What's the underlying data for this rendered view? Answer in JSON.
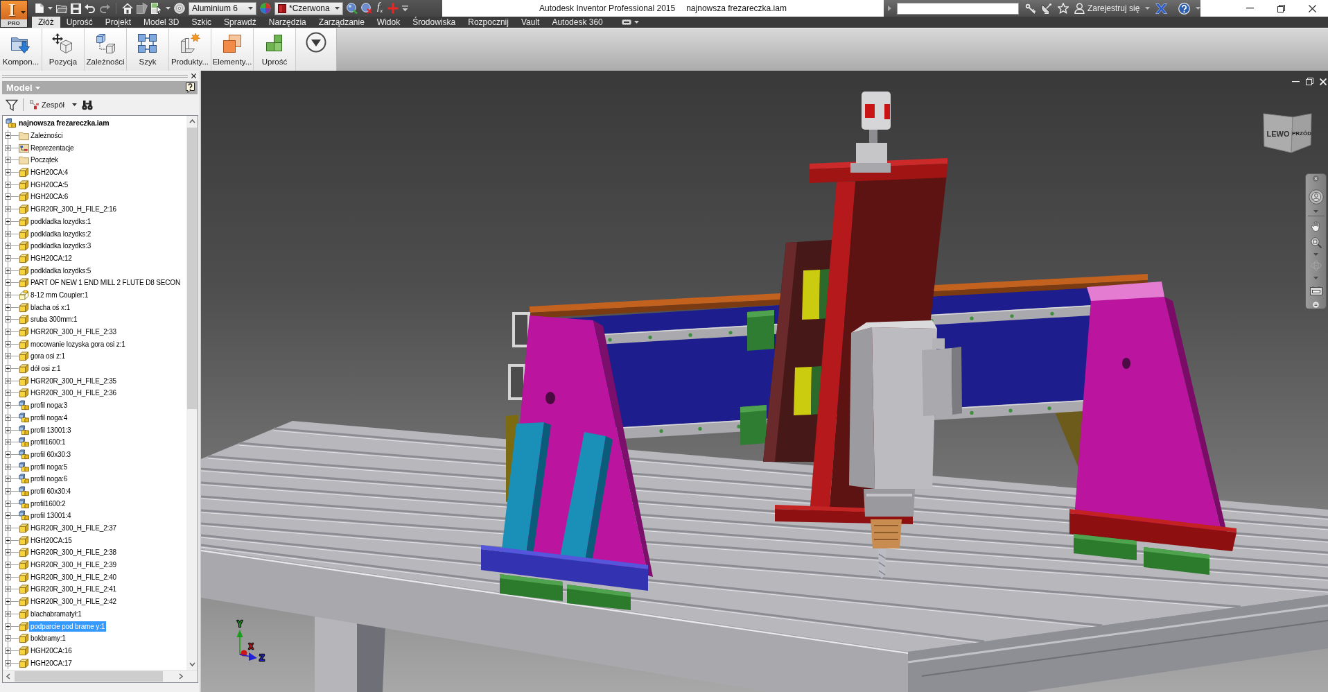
{
  "app_button": {
    "logo": "I",
    "edition": "PRO"
  },
  "quick_access": {
    "material": "Aluminium 6",
    "appearance": "*Czerwona",
    "parameters": "f$_{x}$"
  },
  "window": {
    "title": "Autodesk Inventor Professional 2015",
    "document": "najnowsza frezareczka.iam"
  },
  "info_center": {
    "sign_in": "Zarejestruj się"
  },
  "ribbon": {
    "tabs": [
      {
        "label": "Złóż",
        "selected": true
      },
      {
        "label": "Uprość",
        "selected": false
      },
      {
        "label": "Projekt",
        "selected": false
      },
      {
        "label": "Model 3D",
        "selected": false
      },
      {
        "label": "Szkic",
        "selected": false
      },
      {
        "label": "Sprawdź",
        "selected": false
      },
      {
        "label": "Narzędzia",
        "selected": false
      },
      {
        "label": "Zarządzanie",
        "selected": false
      },
      {
        "label": "Widok",
        "selected": false
      },
      {
        "label": "Środowiska",
        "selected": false
      },
      {
        "label": "Rozpocznij",
        "selected": false
      },
      {
        "label": "Vault",
        "selected": false
      },
      {
        "label": "Autodesk 360",
        "selected": false
      }
    ],
    "tools": [
      {
        "label": "Kompon...",
        "kind": "place"
      },
      {
        "label": "Pozycja",
        "kind": "move"
      },
      {
        "label": "Zależności",
        "kind": "constrain"
      },
      {
        "label": "Szyk",
        "kind": "pattern"
      },
      {
        "label": "Produkty...",
        "kind": "productivity"
      },
      {
        "label": "Elementy...",
        "kind": "components"
      },
      {
        "label": "Uprość",
        "kind": "simplify"
      }
    ]
  },
  "browser": {
    "title": "Model",
    "view": "Zespół",
    "tree": {
      "label": "najnowsza frezareczka.iam",
      "kind": "assembly",
      "selected": false,
      "children": [
        {
          "label": "Zależności",
          "kind": "folder",
          "expanded": false,
          "selected": false
        },
        {
          "label": "Reprezentacje",
          "kind": "representations",
          "expanded": false,
          "selected": false
        },
        {
          "label": "Początek",
          "kind": "folder",
          "expanded": false,
          "selected": false
        },
        {
          "label": "HGH20CA:4",
          "kind": "part",
          "expanded": false,
          "selected": false
        },
        {
          "label": "HGH20CA:5",
          "kind": "part",
          "expanded": false,
          "selected": false
        },
        {
          "label": "HGH20CA:6",
          "kind": "part",
          "expanded": false,
          "selected": false
        },
        {
          "label": "HGR20R_300_H_FILE_2:16",
          "kind": "part",
          "expanded": false,
          "selected": false
        },
        {
          "label": "podkladka lozydks:1",
          "kind": "part",
          "expanded": false,
          "selected": false
        },
        {
          "label": "podkladka lozydks:2",
          "kind": "part",
          "expanded": false,
          "selected": false
        },
        {
          "label": "podkladka lozydks:3",
          "kind": "part",
          "expanded": false,
          "selected": false
        },
        {
          "label": "HGH20CA:12",
          "kind": "part",
          "expanded": false,
          "selected": false
        },
        {
          "label": "podkladka lozydks:5",
          "kind": "part",
          "expanded": false,
          "selected": false
        },
        {
          "label": "PART OF NEW 1 END MILL 2 FLUTE D8 SECON",
          "kind": "part",
          "expanded": false,
          "selected": false
        },
        {
          "label": "8-12 mm Coupler:1",
          "kind": "part_outline",
          "expanded": false,
          "selected": false
        },
        {
          "label": "blacha oś x:1",
          "kind": "part",
          "expanded": false,
          "selected": false
        },
        {
          "label": "sruba 300mm:1",
          "kind": "part",
          "expanded": false,
          "selected": false
        },
        {
          "label": "HGR20R_300_H_FILE_2:33",
          "kind": "part",
          "expanded": false,
          "selected": false
        },
        {
          "label": "mocowanie lozyska gora osi z:1",
          "kind": "part",
          "expanded": false,
          "selected": false
        },
        {
          "label": "gora osi z:1",
          "kind": "part",
          "expanded": false,
          "selected": false
        },
        {
          "label": "dół osi z:1",
          "kind": "part",
          "expanded": false,
          "selected": false
        },
        {
          "label": "HGR20R_300_H_FILE_2:35",
          "kind": "part",
          "expanded": false,
          "selected": false
        },
        {
          "label": "HGR20R_300_H_FILE_2:36",
          "kind": "part",
          "expanded": false,
          "selected": false
        },
        {
          "label": "profil noga:3",
          "kind": "assembly",
          "expanded": false,
          "selected": false
        },
        {
          "label": "profil noga:4",
          "kind": "assembly",
          "expanded": false,
          "selected": false
        },
        {
          "label": "profil 13001:3",
          "kind": "assembly",
          "expanded": false,
          "selected": false
        },
        {
          "label": "profil1600:1",
          "kind": "assembly",
          "expanded": false,
          "selected": false
        },
        {
          "label": "profil 60x30:3",
          "kind": "assembly",
          "expanded": false,
          "selected": false
        },
        {
          "label": "profil noga:5",
          "kind": "assembly",
          "expanded": false,
          "selected": false
        },
        {
          "label": "profil noga:6",
          "kind": "assembly",
          "expanded": false,
          "selected": false
        },
        {
          "label": "profil 60x30:4",
          "kind": "assembly",
          "expanded": false,
          "selected": false
        },
        {
          "label": "profil1600:2",
          "kind": "assembly",
          "expanded": false,
          "selected": false
        },
        {
          "label": "profil 13001:4",
          "kind": "assembly",
          "expanded": false,
          "selected": false
        },
        {
          "label": "HGR20R_300_H_FILE_2:37",
          "kind": "part",
          "expanded": false,
          "selected": false
        },
        {
          "label": "HGH20CA:15",
          "kind": "part",
          "expanded": false,
          "selected": false
        },
        {
          "label": "HGR20R_300_H_FILE_2:38",
          "kind": "part",
          "expanded": false,
          "selected": false
        },
        {
          "label": "HGR20R_300_H_FILE_2:39",
          "kind": "part",
          "expanded": false,
          "selected": false
        },
        {
          "label": "HGR20R_300_H_FILE_2:40",
          "kind": "part",
          "expanded": false,
          "selected": false
        },
        {
          "label": "HGR20R_300_H_FILE_2:41",
          "kind": "part",
          "expanded": false,
          "selected": false
        },
        {
          "label": "HGR20R_300_H_FILE_2:42",
          "kind": "part",
          "expanded": false,
          "selected": false
        },
        {
          "label": "blachabramatył:1",
          "kind": "part",
          "expanded": false,
          "selected": false
        },
        {
          "label": "podparcie pod brame y:1",
          "kind": "part",
          "expanded": false,
          "selected": true
        },
        {
          "label": "bokbramy:1",
          "kind": "part",
          "expanded": false,
          "selected": false
        },
        {
          "label": "HGH20CA:16",
          "kind": "part",
          "expanded": false,
          "selected": false
        },
        {
          "label": "HGH20CA:17",
          "kind": "part",
          "expanded": false,
          "selected": false
        }
      ]
    }
  },
  "viewport": {
    "view_cube": [
      "LEWO",
      "PRZÓD"
    ],
    "axes": [
      {
        "label": "Y",
        "color": "#1a9e1a"
      },
      {
        "label": "X",
        "color": "#d01414"
      },
      {
        "label": "Z",
        "color": "#2222d2"
      }
    ]
  }
}
